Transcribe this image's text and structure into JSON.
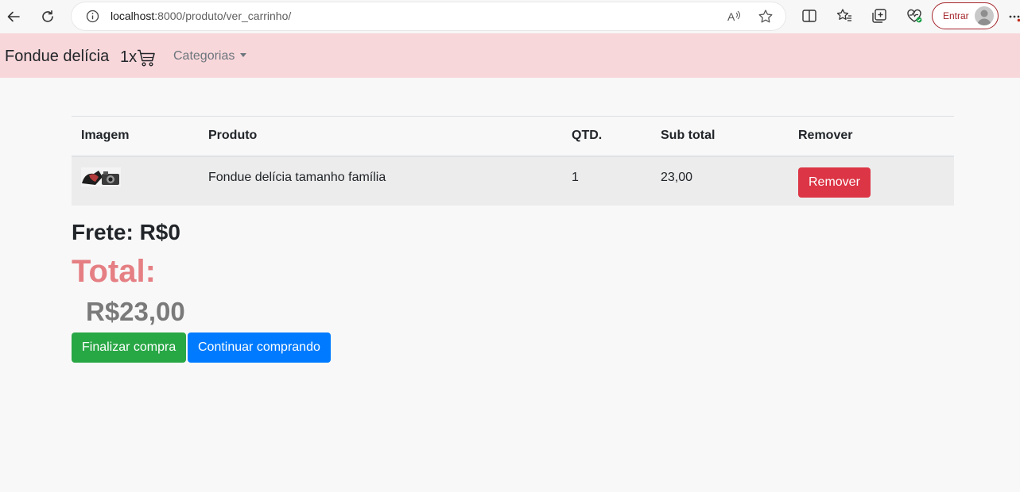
{
  "browser": {
    "url_host": "localhost",
    "url_rest": ":8000/produto/ver_carrinho/",
    "signin_label": "Entrar"
  },
  "navbar": {
    "brand": "Fondue delícia",
    "cart_count": "1x",
    "categories_label": "Categorias"
  },
  "table": {
    "headers": [
      "Imagem",
      "Produto",
      "QTD.",
      "Sub total",
      "Remover"
    ],
    "rows": [
      {
        "produto": "Fondue delícia tamanho família",
        "qtd": "1",
        "subtotal": "23,00",
        "remove_label": "Remover"
      }
    ]
  },
  "summary": {
    "frete": "Frete: R$0",
    "total_label": "Total:",
    "total_value": "R$23,00"
  },
  "actions": {
    "finalizar_label": "Finalizar compra",
    "continuar_label": "Continuar comprando"
  },
  "colors": {
    "navbar_bg": "#f8d7da",
    "remove": "#dc3545",
    "finalizar": "#28a745",
    "continuar": "#007bff",
    "total_label": "#e57f83"
  }
}
